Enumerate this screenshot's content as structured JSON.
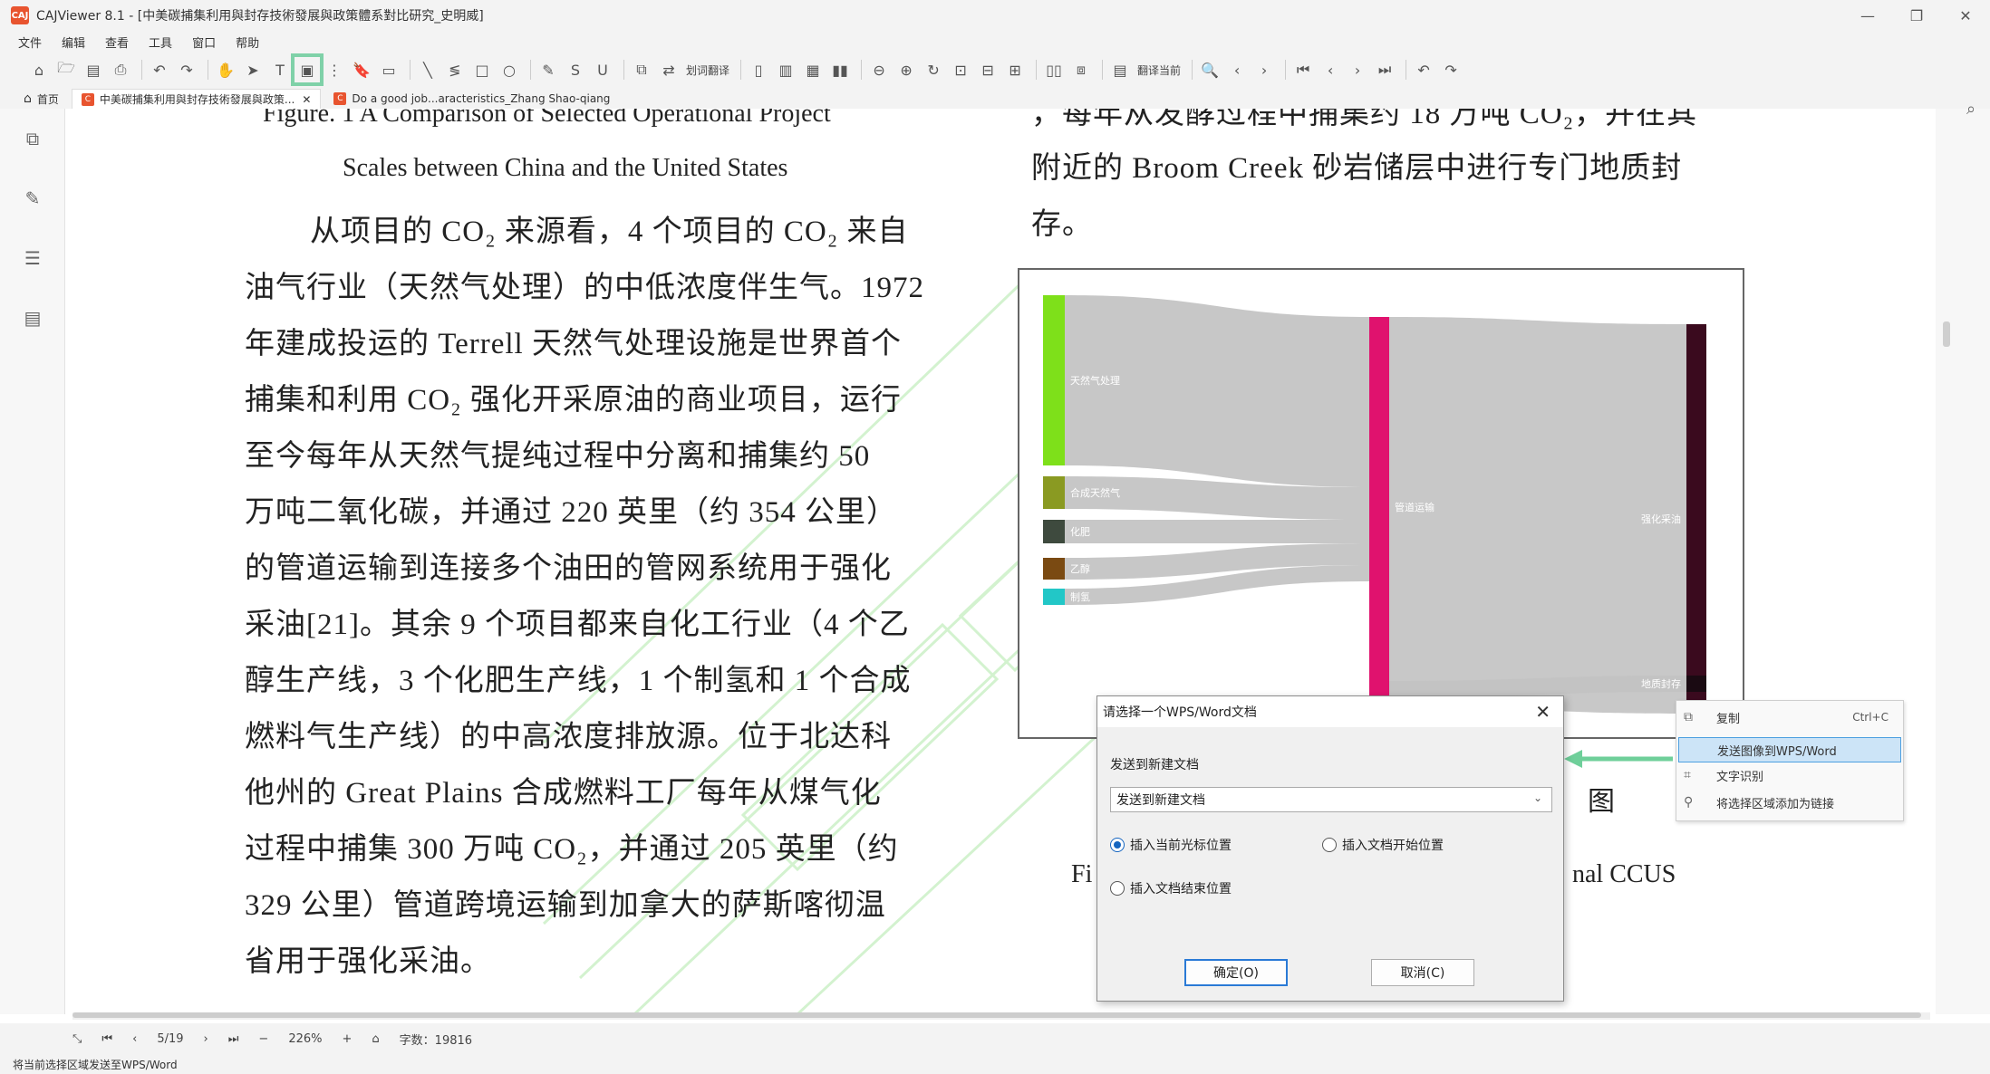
{
  "window": {
    "title": "CAJViewer 8.1 - [中美碳捕集利用與封存技術發展與政策體系對比研究_史明威]",
    "app_logo": "CAJ",
    "controls": [
      "—",
      "❐",
      "✕"
    ]
  },
  "menu": [
    "文件",
    "编辑",
    "查看",
    "工具",
    "窗口",
    "帮助"
  ],
  "toolbar": {
    "translate_label": "划词翻译",
    "translate_page_label": "翻译当前"
  },
  "tabs": {
    "home": "首页",
    "doc1": "中美碳捕集利用與封存技術發展與政策...",
    "doc2": "Do a good job...aracteristics_Zhang Shao-qiang",
    "close": "✕"
  },
  "document": {
    "fig_caption_1": "Figure. 1    A Comparison of Selected Operational Project",
    "fig_caption_2": "Scales between China and the United States",
    "left_lines": [
      "从项目的 CO₂ 来源看，4 个项目的 CO₂ 来自",
      "油气行业（天然气处理）的中低浓度伴生气。1972",
      "年建成投运的 Terrell 天然气处理设施是世界首个",
      "捕集和利用 CO₂ 强化开采原油的商业项目，运行",
      "至今每年从天然气提纯过程中分离和捕集约  50",
      "万吨二氧化碳，并通过 220 英里（约 354 公里）",
      "的管道运输到连接多个油田的管网系统用于强化",
      "采油[21]。其余 9 个项目都来自化工行业（4 个乙",
      "醇生产线，3 个化肥生产线，1 个制氢和 1 个合成",
      "燃料气生产线）的中高浓度排放源。位于北达科",
      "他州的 Great Plains 合成燃料工厂每年从煤气化",
      "过程中捕集 300 万吨 CO₂，并通过 205 英里（约",
      "329  公里）管道跨境运输到加拿大的萨斯喀彻温",
      "省用于强化采油。"
    ],
    "right_lines": [
      "，每年从发酵过程中捕集约 18 万吨 CO₂，并在其",
      "附近的 Broom Creek 砂岩储层中进行专门地质封",
      "存。"
    ],
    "fig2_partial_char": "图",
    "fig2_caption_left": "Fi",
    "fig2_caption_right": "nal CCUS"
  },
  "chart_data": {
    "type": "sankey",
    "sources": [
      {
        "name": "天然气处理",
        "color": "#7ee01a"
      },
      {
        "name": "合成天然气",
        "color": "#8a9a22"
      },
      {
        "name": "化肥",
        "color": "#3e4a3e"
      },
      {
        "name": "乙醇",
        "color": "#7a4a12"
      },
      {
        "name": "制氢",
        "color": "#22c7c7"
      }
    ],
    "middle": [
      {
        "name": "管道运输",
        "color": "#e0126e"
      }
    ],
    "targets": [
      {
        "name": "强化采油",
        "color": "#3a0a1e"
      },
      {
        "name": "地质封存",
        "color": "#1a0a12"
      }
    ]
  },
  "context_menu": {
    "items": [
      {
        "icon": "copy-icon",
        "label": "复制",
        "shortcut": "Ctrl+C"
      },
      {
        "icon": "send-icon",
        "label": "发送图像到WPS/Word",
        "shortcut": ""
      },
      {
        "icon": "ocr-icon",
        "label": "文字识别",
        "shortcut": ""
      },
      {
        "icon": "link-icon",
        "label": "将选择区域添加为链接",
        "shortcut": ""
      }
    ]
  },
  "dialog": {
    "title": "请选择一个WPS/Word文档",
    "label": "发送到新建文档",
    "select_value": "发送到新建文档",
    "radio_cursor": "插入当前光标位置",
    "radio_start": "插入文档开始位置",
    "radio_end": "插入文档结束位置",
    "ok": "确定(O)",
    "cancel": "取消(C)"
  },
  "pagebar": {
    "page": "5/19",
    "zoom": "226%",
    "word_count": "字数：19816"
  },
  "status": "将当前选择区域发送至WPS/Word"
}
